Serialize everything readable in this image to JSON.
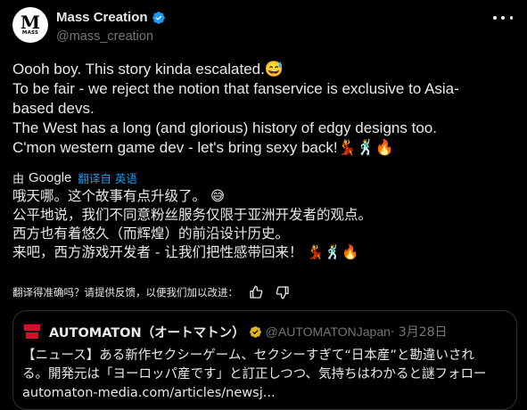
{
  "author": {
    "avatar_mark": "M",
    "avatar_text": "MASS",
    "display_name": "Mass Creation",
    "handle": "@mass_creation",
    "verified": true
  },
  "tweet": {
    "lines": [
      "Oooh boy. This story kinda escalated.😅",
      "To be fair - we reject the notion that fanservice is exclusive to Asia-",
      "based devs.",
      "The West has a long (and glorious) history of edgy designs too.",
      "C'mon western game dev - let's bring sexy back!💃🕺🔥"
    ]
  },
  "translation": {
    "by_label": "由",
    "google_label": "Google",
    "source_label": "翻译自 英语",
    "lines": [
      "哦天哪。这个故事有点升级了。 😅",
      "公平地说，我们不同意粉丝服务仅限于亚洲开发者的观点。",
      "西方也有着悠久（而辉煌）的前沿设计历史。",
      "来吧，西方游戏开发者 - 让我们把性感带回来！ 💃🕺🔥"
    ],
    "feedback_prompt": "翻译得准确吗？请提供反馈，以便我们加以改进："
  },
  "quote": {
    "name": "AUTOMATON（オートマトン）",
    "handle": "@AUTOMATONJapan",
    "date": "· 3月28日",
    "lines": [
      "【ニュース】ある新作セクシーゲーム、セクシーすぎて“日本産”と勘違いされ",
      "る。開発元は「ヨーロッパ産です」と訂正しつつ、気持ちはわかると謎フォロー",
      "automaton-media.com/articles/newsj..."
    ]
  },
  "icons": {
    "verified_badge": "verified-badge-icon",
    "more": "more-horizontal-icon",
    "thumbs_up": "thumbs-up-icon",
    "thumbs_down": "thumbs-down-icon",
    "affiliate_badge": "gold-affiliate-badge-icon"
  },
  "colors": {
    "background": "#000000",
    "text": "#e7e9ea",
    "secondary_text": "#71767b",
    "link": "#1d9bf0",
    "verified": "#1d9bf0",
    "border": "#2f3336",
    "gold_badge": "#e2b719"
  }
}
